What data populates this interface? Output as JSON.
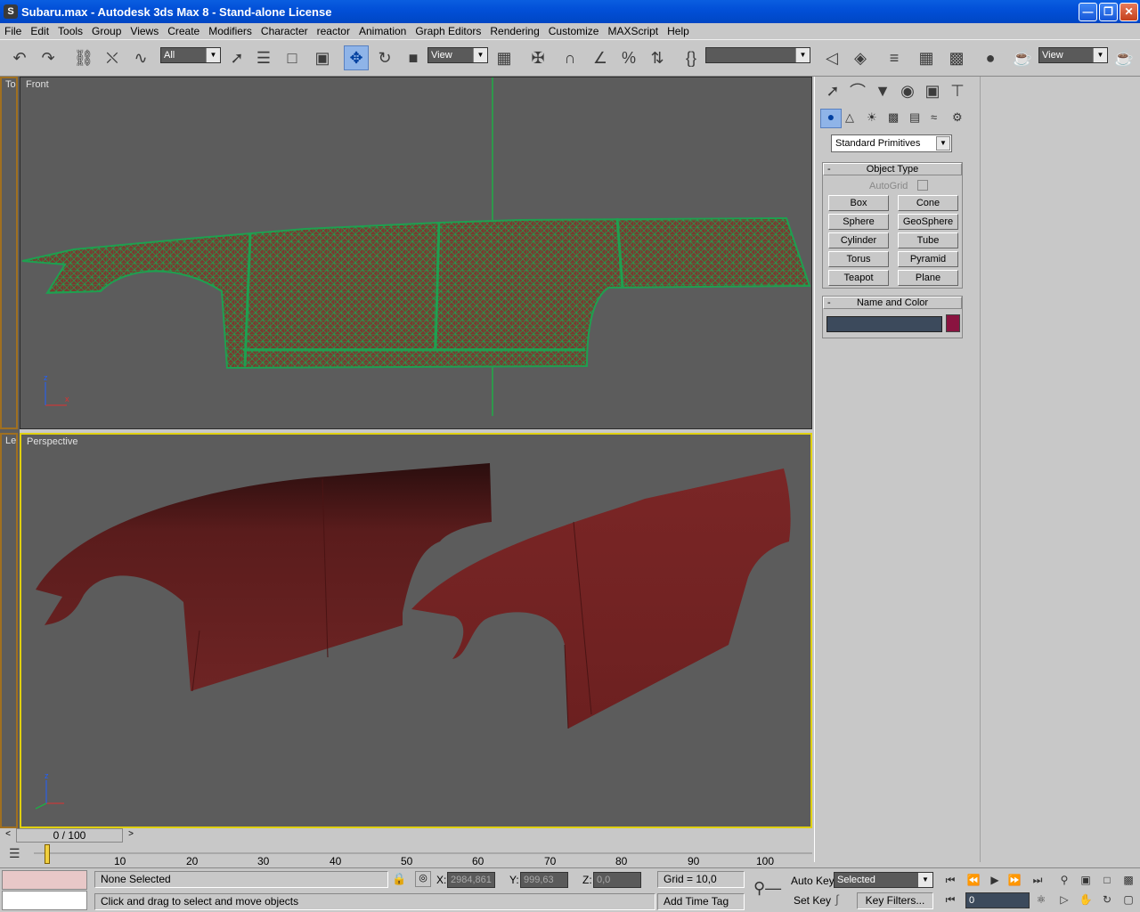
{
  "window": {
    "title": "Subaru.max - Autodesk 3ds Max 8  - Stand-alone License"
  },
  "menu": [
    "File",
    "Edit",
    "Tools",
    "Group",
    "Views",
    "Create",
    "Modifiers",
    "Character",
    "reactor",
    "Animation",
    "Graph Editors",
    "Rendering",
    "Customize",
    "MAXScript",
    "Help"
  ],
  "toolbar": {
    "selection_filter": "All",
    "ref_coord": "View",
    "named_sel": "",
    "render_view": "View"
  },
  "viewports": {
    "top_small_label": "To",
    "front_label": "Front",
    "left_small_label": "Le",
    "perspective_label": "Perspective"
  },
  "command_panel": {
    "category": "Standard Primitives",
    "object_type_title": "Object Type",
    "autogrid_label": "AutoGrid",
    "buttons": [
      "Box",
      "Cone",
      "Sphere",
      "GeoSphere",
      "Cylinder",
      "Tube",
      "Torus",
      "Pyramid",
      "Teapot",
      "Plane"
    ],
    "name_color_title": "Name and Color",
    "object_name": "",
    "color": "#8a1440"
  },
  "timeline": {
    "frame_display": "0 / 100",
    "ticks": [
      "10",
      "20",
      "30",
      "40",
      "50",
      "60",
      "70",
      "80",
      "90",
      "100"
    ]
  },
  "status": {
    "selection": "None Selected",
    "prompt": "Click and drag to select and move objects",
    "x_label": "X:",
    "x_value": "2984,861",
    "y_label": "Y:",
    "y_value": "999,63",
    "z_label": "Z:",
    "z_value": "0,0",
    "grid": "Grid = 10,0",
    "add_time_tag": "Add Time Tag",
    "auto_key": "Auto Key",
    "set_key": "Set Key",
    "key_mode": "Selected",
    "key_filters": "Key Filters...",
    "current_frame": "0"
  },
  "colors": {
    "wire": "#1ea050",
    "mesh_fill": "#8a2a2a",
    "viewport_bg": "#5c5c5c",
    "active_border": "#e0d010",
    "axis_blue": "#2060ff",
    "axis_red": "#e03030"
  }
}
